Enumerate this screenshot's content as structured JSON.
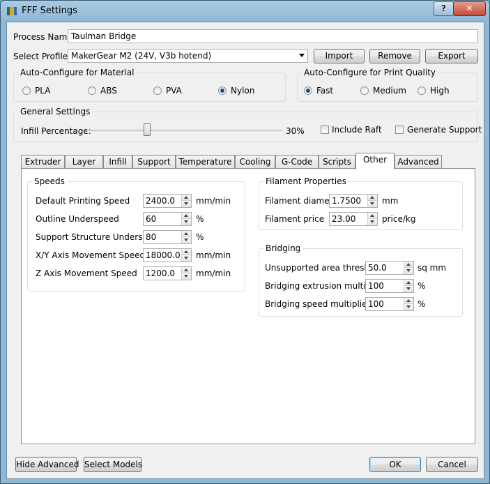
{
  "window": {
    "title": "FFF Settings",
    "help_label": "?",
    "close_label": "✕"
  },
  "process": {
    "label": "Process Name:",
    "value": "Taulman Bridge"
  },
  "profile": {
    "label": "Select Profile:",
    "selected": "MakerGear M2 (24V, V3b hotend)",
    "import_label": "Import",
    "remove_label": "Remove",
    "export_label": "Export"
  },
  "material": {
    "title": "Auto-Configure for Material",
    "options": [
      "PLA",
      "ABS",
      "PVA",
      "Nylon"
    ],
    "selected": "Nylon"
  },
  "quality": {
    "title": "Auto-Configure for Print Quality",
    "options": [
      "Fast",
      "Medium",
      "High"
    ],
    "selected": "Fast"
  },
  "general": {
    "title": "General Settings",
    "infill_label": "Infill Percentage:",
    "infill_value_text": "30%",
    "infill_value": 30,
    "raft_label": "Include Raft",
    "raft_checked": false,
    "support_label": "Generate Support",
    "support_checked": false
  },
  "tabs": [
    "Extruder",
    "Layer",
    "Infill",
    "Support",
    "Temperature",
    "Cooling",
    "G-Code",
    "Scripts",
    "Other",
    "Advanced"
  ],
  "active_tab": "Other",
  "speeds": {
    "title": "Speeds",
    "rows": [
      {
        "label": "Default Printing Speed",
        "value": "2400.0",
        "unit": "mm/min"
      },
      {
        "label": "Outline Underspeed",
        "value": "60",
        "unit": "%"
      },
      {
        "label": "Support Structure Underspeed",
        "value": "80",
        "unit": "%"
      },
      {
        "label": "X/Y Axis Movement Speed",
        "value": "18000.0",
        "unit": "mm/min"
      },
      {
        "label": "Z Axis Movement Speed",
        "value": "1200.0",
        "unit": "mm/min"
      }
    ]
  },
  "filament": {
    "title": "Filament Properties",
    "rows": [
      {
        "label": "Filament diameter",
        "value": "1.7500",
        "unit": "mm"
      },
      {
        "label": "Filament price",
        "value": "23.00",
        "unit": "price/kg"
      }
    ]
  },
  "bridging": {
    "title": "Bridging",
    "rows": [
      {
        "label": "Unsupported area threshold",
        "value": "50.0",
        "unit": "sq mm"
      },
      {
        "label": "Bridging extrusion multiplier",
        "value": "100",
        "unit": "%"
      },
      {
        "label": "Bridging speed multiplier",
        "value": "100",
        "unit": "%"
      }
    ]
  },
  "footer": {
    "hide_advanced_label": "Hide Advanced",
    "select_models_label": "Select Models",
    "ok_label": "OK",
    "cancel_label": "Cancel"
  }
}
